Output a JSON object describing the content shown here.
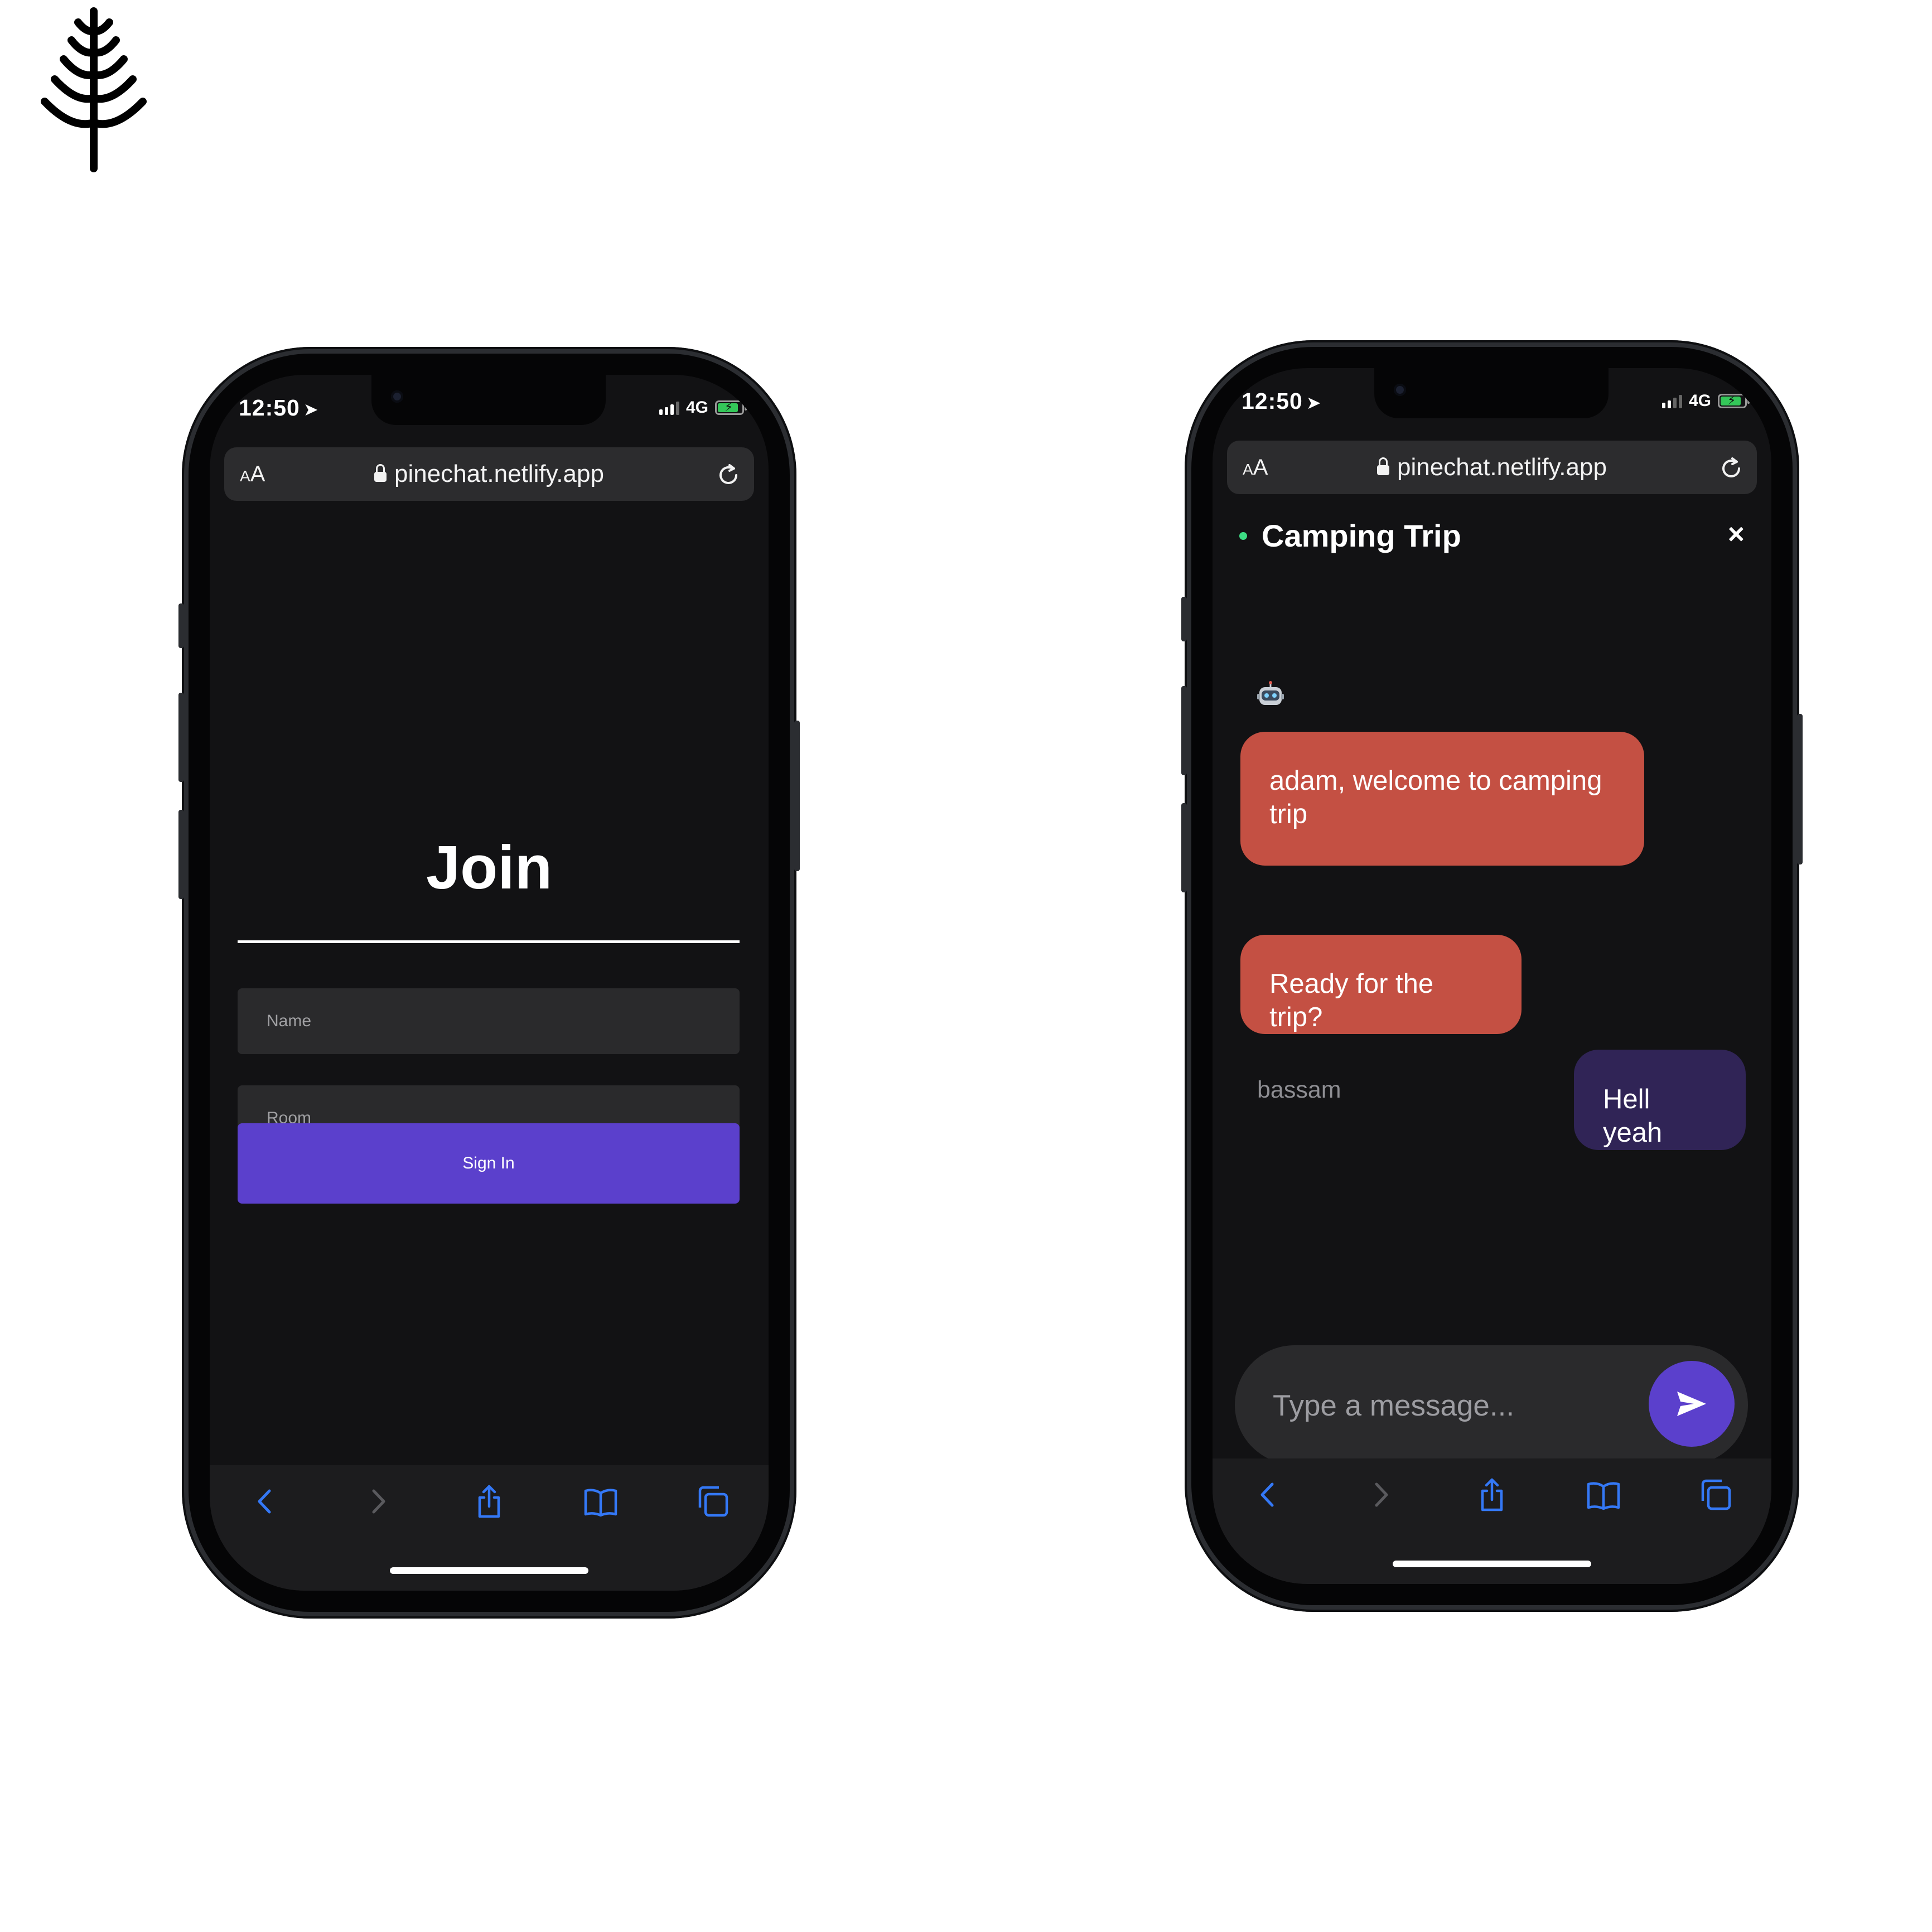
{
  "brand": {
    "logo_icon": "pine-tree-icon"
  },
  "colors": {
    "accent": "#5b40cc",
    "incoming_bubble": "#c45043",
    "outgoing_bubble": "#302456",
    "online": "#3ddc84"
  },
  "left_phone": {
    "status": {
      "time": "12:50",
      "network": "4G"
    },
    "browser": {
      "text_size_label_small": "A",
      "text_size_label_large": "A",
      "url": "pinechat.netlify.app"
    },
    "join": {
      "title": "Join",
      "name_placeholder": "Name",
      "room_placeholder": "Room",
      "sign_in_label": "Sign In"
    },
    "toolbar": [
      "back-icon",
      "forward-icon",
      "share-icon",
      "bookmarks-icon",
      "tabs-icon"
    ]
  },
  "right_phone": {
    "status": {
      "time": "12:50",
      "network": "4G"
    },
    "browser": {
      "text_size_label_small": "A",
      "text_size_label_large": "A",
      "url": "pinechat.netlify.app"
    },
    "chat": {
      "room_name": "Camping Trip",
      "close_symbol": "×",
      "bot_icon": "robot-icon",
      "messages": [
        {
          "text": "adam, welcome to camping trip",
          "direction": "incoming"
        },
        {
          "sender": "bassam",
          "text": "Ready for the trip?",
          "direction": "incoming"
        },
        {
          "text": "Hell yeah",
          "direction": "outgoing"
        }
      ],
      "composer_placeholder": "Type a message...",
      "send_icon": "send-icon"
    },
    "toolbar": [
      "back-icon",
      "forward-icon",
      "share-icon",
      "bookmarks-icon",
      "tabs-icon"
    ]
  }
}
